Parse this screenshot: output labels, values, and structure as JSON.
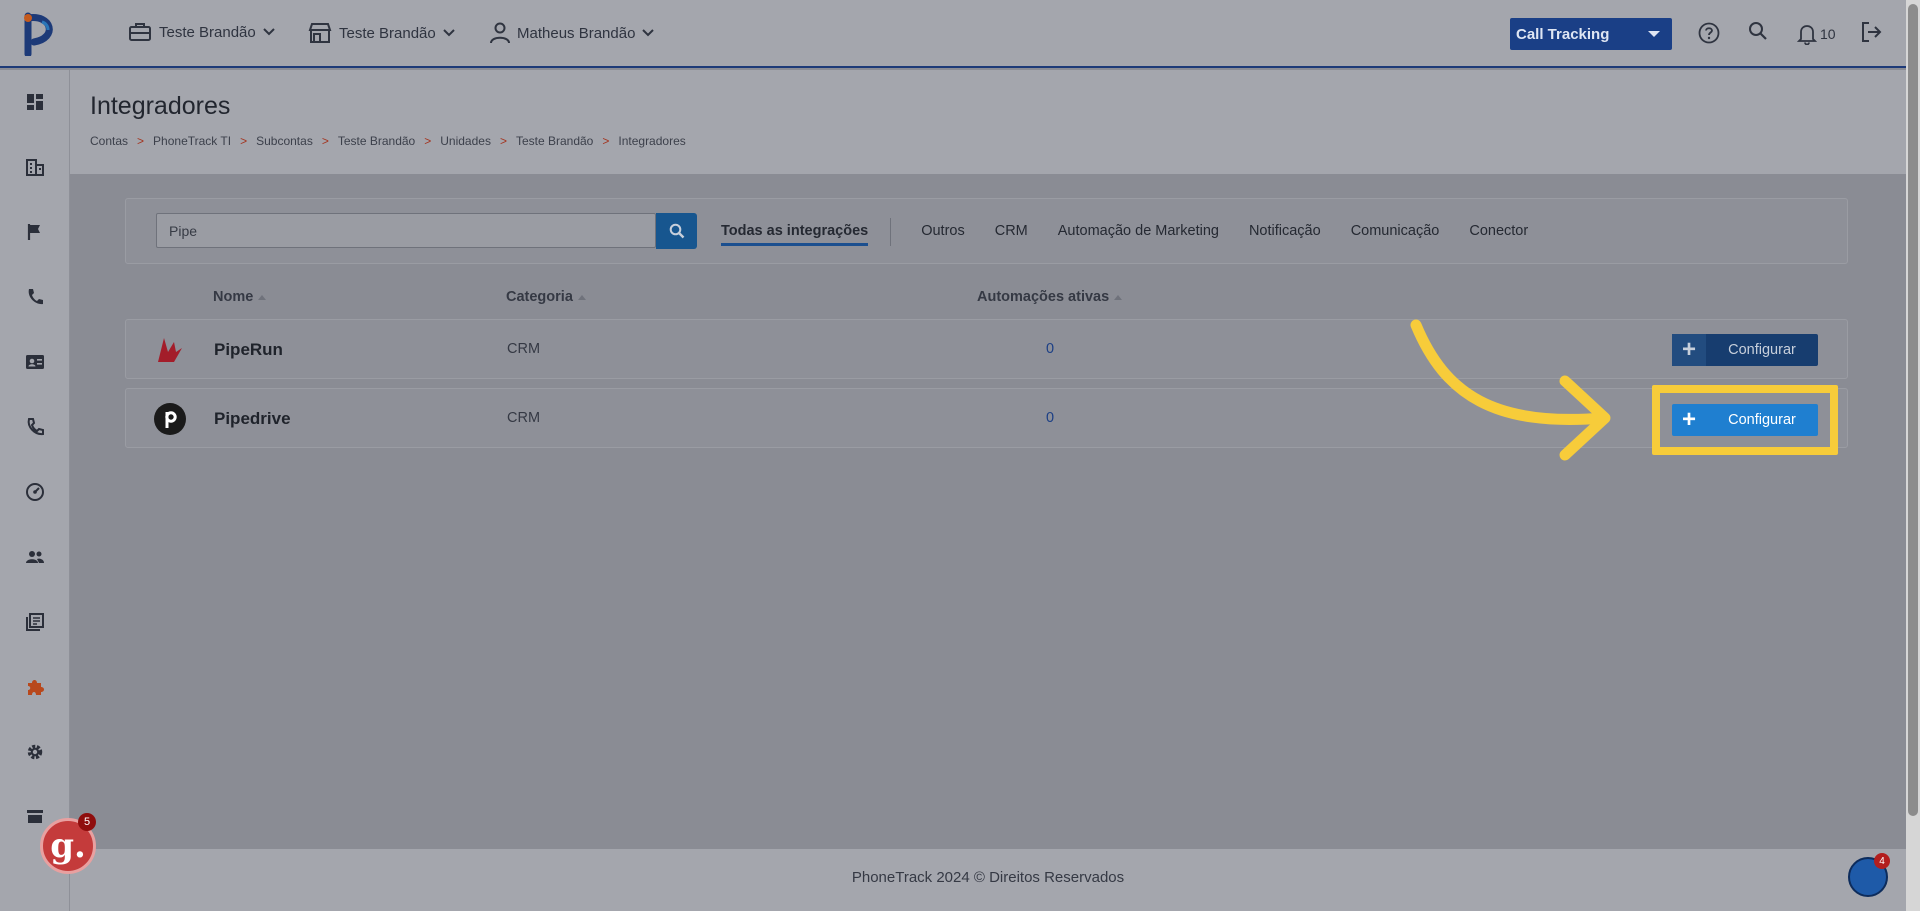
{
  "header": {
    "account_menu": "Teste Brandão",
    "unit_menu": "Teste Brandão",
    "user_menu": "Matheus Brandão",
    "product_select": "Call Tracking",
    "notification_count": "10"
  },
  "page": {
    "title": "Integradores",
    "breadcrumb": [
      "Contas",
      "PhoneTrack TI",
      "Subcontas",
      "Teste Brandão",
      "Unidades",
      "Teste Brandão",
      "Integradores"
    ],
    "breadcrumb_separator": ">"
  },
  "filter": {
    "search_value": "Pipe",
    "tabs": [
      "Todas as integrações",
      "Outros",
      "CRM",
      "Automação de Marketing",
      "Notificação",
      "Comunicação",
      "Conector"
    ],
    "active_tab": "Todas as integrações"
  },
  "table": {
    "columns": [
      "Nome",
      "Categoria",
      "Automações ativas"
    ],
    "rows": [
      {
        "name": "PipeRun",
        "category": "CRM",
        "active_automations": "0",
        "button": "Configurar",
        "icon": "piperun-logo-icon"
      },
      {
        "name": "Pipedrive",
        "category": "CRM",
        "active_automations": "0",
        "button": "Configurar",
        "icon": "pipedrive-logo-icon"
      }
    ]
  },
  "footer": {
    "text": "PhoneTrack 2024 © Direitos Reservados"
  },
  "widgets": {
    "g_badge": "5",
    "p_badge": "4"
  },
  "colors": {
    "accent_highlight": "#f7cc3a",
    "primary_button": "#1f7fd0",
    "header_border": "#1d3a78"
  }
}
